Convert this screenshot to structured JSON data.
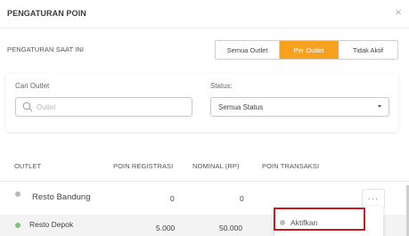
{
  "modal": {
    "title": "PENGATURAN POIN",
    "close_label": "×"
  },
  "settings": {
    "label": "PENGATURAN SAAT INI",
    "options": [
      "Semua Outlet",
      "Per Outlet",
      "Tidak Aktif"
    ],
    "active_option": "Per Outlet"
  },
  "filter": {
    "outlet_label": "Cari Outlet",
    "search_placeholder": "Outlet",
    "status_label": "Status:",
    "status_value": "Semua Status"
  },
  "table": {
    "headers": [
      "OUTLET",
      "POIN REGISTRASI",
      "NOMINAL (RP)",
      "POIN TRANSAKSI"
    ],
    "rows": [
      {
        "outlet": "Resto Bandung",
        "poin_registrasi": "0",
        "nominal": "0",
        "status": "inactive"
      },
      {
        "outlet": "Resto Depok",
        "poin_registrasi": "5.000",
        "nominal": "50.000",
        "status": "active"
      }
    ]
  },
  "actions": {
    "more_label": "···",
    "menu_item": "Aktifkan"
  },
  "colors": {
    "accent": "#f6a21e",
    "active_dot": "#7cc775",
    "inactive_dot": "#b8b8b8",
    "highlight": "#d0161e"
  }
}
